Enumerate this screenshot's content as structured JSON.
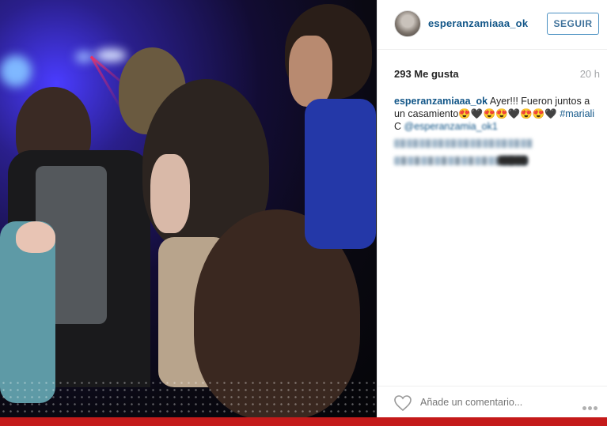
{
  "post": {
    "username": "esperanzamiaaa_ok",
    "follow_label": "SEGUIR",
    "likes": "293 Me gusta",
    "time": "20 h",
    "caption_user": "esperanzamiaaa_ok",
    "caption_text_1": " Ayer!!! Fueron juntos a un casamiento",
    "caption_emojis": "😍🖤😍😍🖤😍😍🖤",
    "caption_hashtag": "#mariali",
    "caption_prefix_c": "C ",
    "caption_mention": "@esperanzamia_ok1",
    "comment_placeholder": "Añade un comentario..."
  },
  "colors": {
    "accent": "#125688",
    "follow_border": "#4a90c2",
    "bottom_bar": "#c41a1a"
  },
  "icons": [
    "heart-icon",
    "more-options-icon",
    "avatar"
  ]
}
